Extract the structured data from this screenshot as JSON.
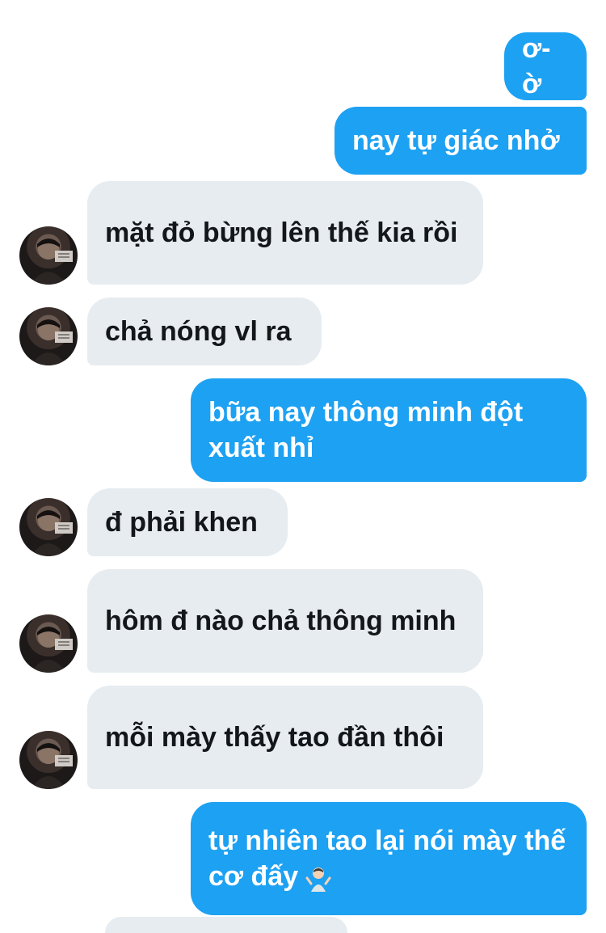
{
  "colors": {
    "sent": "#1da1f2",
    "received": "#e6ecf0",
    "sent_text": "#ffffff",
    "received_text": "#14171a"
  },
  "messages": [
    {
      "side": "sent",
      "text": "ơ-ờ"
    },
    {
      "side": "sent",
      "text": "nay tự giác nhở"
    },
    {
      "side": "received",
      "text": "mặt đỏ bừng lên thế kia rồi",
      "avatar": "user-avatar"
    },
    {
      "side": "received",
      "text": "chả nóng vl ra",
      "avatar": "user-avatar"
    },
    {
      "side": "sent",
      "text": "bữa nay thông minh đột xuất nhỉ"
    },
    {
      "side": "received",
      "text": "đ phải khen",
      "avatar": "user-avatar"
    },
    {
      "side": "received",
      "text": "hôm đ nào chả thông minh",
      "avatar": "user-avatar"
    },
    {
      "side": "received",
      "text": "mỗi mày thấy tao đần thôi",
      "avatar": "user-avatar"
    },
    {
      "side": "sent",
      "text": "tự nhiên tao lại nói mày thế cơ đấy",
      "emoji": "person-shrugging-emoji"
    }
  ]
}
